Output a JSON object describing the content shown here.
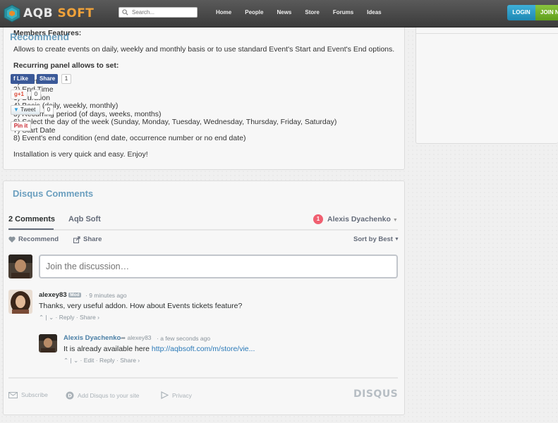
{
  "header": {
    "logo_text_a": "AQB",
    "logo_text_b": "SOFT",
    "search_placeholder": "Search...",
    "nav": [
      "Home",
      "People",
      "News",
      "Store",
      "Forums",
      "Ideas"
    ],
    "login_label": "LOGIN",
    "join_label": "JOIN N"
  },
  "description": {
    "members_title": "Members Features:",
    "members_text": "Allows to create events on daily, weekly and monthly basis or to use standard Event's Start and Event's End options.",
    "recurring_title": "Recurring panel allows to set:",
    "items": [
      "1) Start Time",
      "2) End Time",
      "3) Duration",
      "4) Basis (daily, weekly, monthly)",
      "5) Recurring period (of days, weeks, months)",
      "6) Select the day of the week (Sunday, Monday, Tuesday, Wednesday, Thursday, Friday, Saturday)",
      "7) Start Date",
      "8) Event's end condition (end date, occurrence number or no end date)"
    ],
    "closing": "Installation is very quick and easy. Enjoy!"
  },
  "recommend": {
    "title": "Recommend",
    "fb_like": "Like",
    "fb_share": "Share",
    "fb_count": "1",
    "gplus": "+1",
    "gplus_count": "0",
    "tweet": "Tweet",
    "tweet_count": "0",
    "pinit": "Pin it"
  },
  "disqus": {
    "title": "Disqus Comments",
    "tab_comments": "2 Comments",
    "tab_site": "Aqb Soft",
    "notification_count": "1",
    "user_name": "Alexis Dyachenko",
    "recommend_label": "Recommend",
    "share_label": "Share",
    "sort_label": "Sort by Best",
    "join_placeholder": "Join the discussion…",
    "comments": [
      {
        "author": "alexey83",
        "badge": "Mod",
        "time": "9 minutes ago",
        "text": "Thanks, very useful addon. How about Events tickets feature?",
        "actions": "Reply · Share ›"
      },
      {
        "author": "Alexis Dyachenko",
        "reply_to": "alexey83",
        "time": "a few seconds ago",
        "text": "It is already available here ",
        "link": "http://aqbsoft.com/m/store/vie...",
        "actions": "Edit · Reply · Share ›"
      }
    ],
    "footer": {
      "subscribe": "Subscribe",
      "add_disqus": "Add Disqus to your site",
      "privacy": "Privacy",
      "brand": "DISQUS"
    }
  },
  "colors": {
    "accent_blue": "#6b9fbf",
    "link_blue": "#2a79b8",
    "notif_red": "#f05f70",
    "login_blue": "#1e87b3",
    "join_green": "#5f9e1c"
  }
}
